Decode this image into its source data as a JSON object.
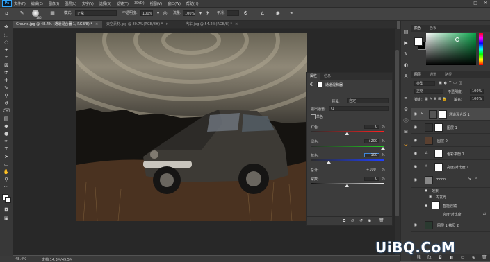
{
  "menubar": {
    "items": [
      "文件(F)",
      "编辑(E)",
      "图像(I)",
      "图层(L)",
      "文字(Y)",
      "选择(S)",
      "滤镜(T)",
      "3D(D)",
      "视图(V)",
      "窗口(W)",
      "帮助(H)"
    ],
    "logo": "Ps"
  },
  "options": {
    "size": "185",
    "mode_label": "模式:",
    "mode_value": "正常",
    "opacity_label": "不透明度:",
    "opacity_value": "100%",
    "flow_label": "流量:",
    "flow_value": "100%",
    "smooth_label": "平滑:"
  },
  "tabs": [
    {
      "label": "Ground.jpg @ 48.4% (通道混合器 1, RGB/8) *"
    },
    {
      "label": "天空素材.jpg @ 80.7%(RGB/8#) *"
    },
    {
      "label": "汽车.jpg @ 54.2%(RGB/8) *"
    }
  ],
  "status": {
    "zoom": "48.4%",
    "doc": "文档:14.3M/49.5M"
  },
  "properties": {
    "tab_props": "属性",
    "tab_info": "信息",
    "title": "通道混和器",
    "preset_label": "预设:",
    "preset_value": "自定",
    "output_label": "输出通道:",
    "output_value": "红",
    "mono_label": "单色",
    "red_label": "红色:",
    "red_value": "0",
    "red_pct": "%",
    "green_label": "绿色:",
    "green_value": "+200",
    "green_pct": "%",
    "blue_label": "蓝色:",
    "blue_value": "-100",
    "blue_pct": "%",
    "total_label": "总计:",
    "total_value": "+100",
    "total_pct": "%",
    "const_label": "常数:",
    "const_value": "0",
    "const_pct": "%"
  },
  "color_panel": {
    "tab_color": "颜色",
    "tab_swatches": "色板"
  },
  "layers_panel": {
    "tab_layers": "图层",
    "tab_channels": "通道",
    "tab_paths": "路径",
    "kind_label": "类型",
    "blend_value": "正常",
    "opacity_label": "不透明度:",
    "opacity_value": "100%",
    "lock_label": "锁定:",
    "fill_label": "填充:",
    "fill_value": "100%",
    "layers": [
      {
        "name": "通道混合器 1"
      },
      {
        "name": "图层 1"
      },
      {
        "name": "图层 0"
      },
      {
        "name": "色彩平衡 1"
      },
      {
        "name": "亮度/对比度 1"
      },
      {
        "name": "moon"
      },
      {
        "name": "效果"
      },
      {
        "name": "内发光"
      },
      {
        "name": "智能滤镜"
      },
      {
        "name": "亮度/对比度"
      },
      {
        "name": "图层 1 拷贝 2"
      }
    ]
  },
  "watermark": "UiBQ.CoM"
}
